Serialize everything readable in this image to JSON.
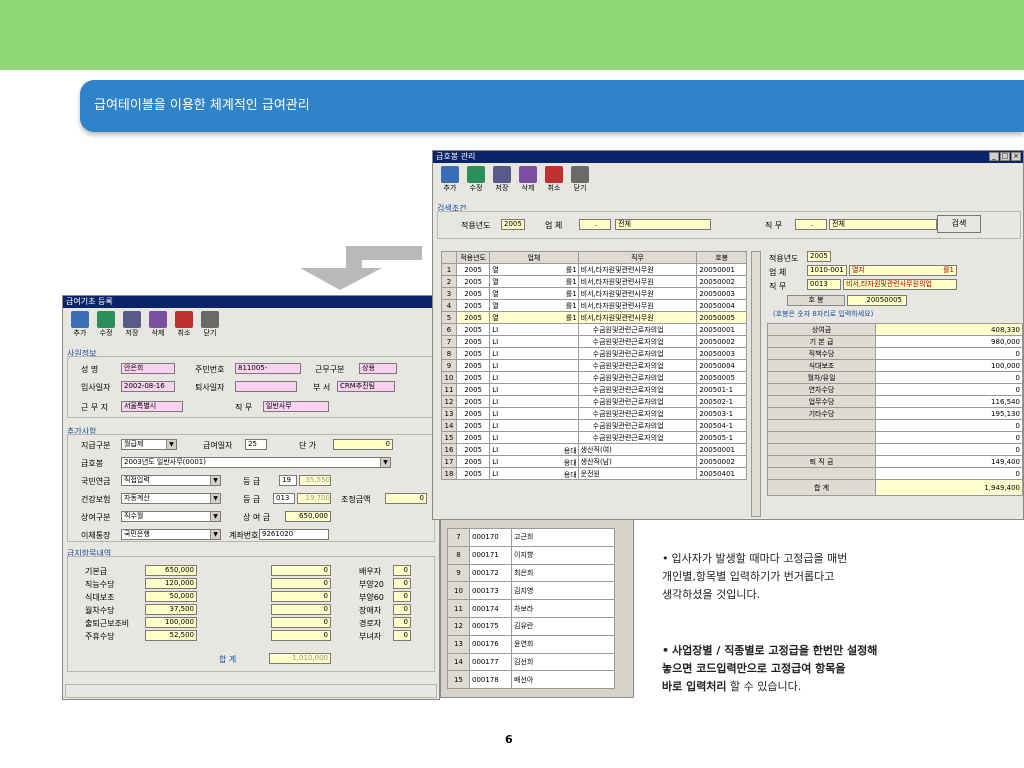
{
  "slide": {
    "title": "급여테이블을 이용한 체계적인 급여관리",
    "page_number": "6",
    "notes": [
      {
        "bullet": "•",
        "lines": [
          "입사자가 발생할 때마다 고정급을 매번",
          "개인별,항목별 입력하기가 번거롭다고",
          "생각하셨을 것입니다."
        ]
      },
      {
        "bullet": "•",
        "lines": [
          "사업장별 / 직종별로 고정급을 한번만 설정해",
          "놓으면 코드입력만으로 고정급여 항목을"
        ],
        "last_bold": "바로 입력처리",
        "last_rest": " 할 수 있습니다."
      }
    ],
    "colors": {
      "topbar": "#8fd878",
      "banner": "#2f84c9"
    }
  },
  "win1": {
    "title": "급여기초 등록",
    "toolbar": [
      {
        "label": "추가",
        "icon": "add-icon"
      },
      {
        "label": "수정",
        "icon": "edit-icon"
      },
      {
        "label": "저장",
        "icon": "save-icon"
      },
      {
        "label": "삭제",
        "icon": "delete-icon"
      },
      {
        "label": "취소",
        "icon": "cancel-icon"
      },
      {
        "label": "닫기",
        "icon": "close-icon"
      }
    ],
    "emp_section": "사원정보",
    "name_label": "성 명",
    "name_value": "안은희",
    "rrn_label": "주민번호",
    "rrn_value": "811005-",
    "worktype_label": "근무구분",
    "worktype_value": "상용",
    "hire_label": "입사일자",
    "hire_value": "2002-08-16",
    "retire_label": "퇴사일자",
    "retire_value": "",
    "dept_label": "부 서",
    "dept_value": "CRM추진팀",
    "site_label": "근 무 지",
    "site_value": "서울특별시",
    "job_label": "직 무",
    "job_value": "일반사무",
    "add_section": "추가사항",
    "paytype_label": "지급구분",
    "paytype_value": "월급제",
    "payday_label": "급여일자",
    "payday_value": "25",
    "unit_label": "단 가",
    "unit_value": "0",
    "grade_label": "급호봉",
    "grade_value": "2003년도 일반사무(0001)",
    "pension_label": "국민연금",
    "pension_value": "직접입력",
    "pgrade_label": "등 급",
    "pgrade_value": "19",
    "pgrade_amt": "35,550",
    "health_label": "건강보험",
    "health_value": "자동계산",
    "hgrade_label": "등 급",
    "hgrade_value": "013",
    "hgrade_amt": "19,700",
    "adjust_label": "조정금액",
    "adjust_value": "0",
    "bonus_label": "상여구분",
    "bonus_value": "직수월",
    "bonus_amt_label": "상 여 금",
    "bonus_amt_value": "650,000",
    "bank_label": "이체통장",
    "bank_value": "국민은행",
    "acct_label": "계좌번호",
    "acct_value": "9261020",
    "items_section": "급지항목내역",
    "items": [
      {
        "label": "기본급",
        "value": "650,000",
        "v2": "0"
      },
      {
        "label": "직능수당",
        "value": "120,000",
        "v2": "0"
      },
      {
        "label": "식대보조",
        "value": "50,000",
        "v2": "0"
      },
      {
        "label": "월차수당",
        "value": "37,500",
        "v2": "0"
      },
      {
        "label": "출퇴근보조비",
        "value": "100,000",
        "v2": "0"
      },
      {
        "label": "주휴수당",
        "value": "52,500",
        "v2": "0"
      }
    ],
    "family": [
      {
        "label": "배우자",
        "value": "0"
      },
      {
        "label": "부양20",
        "value": "0"
      },
      {
        "label": "부양60",
        "value": "0"
      },
      {
        "label": "장애자",
        "value": "0"
      },
      {
        "label": "경로자",
        "value": "0"
      },
      {
        "label": "부녀자",
        "value": "0"
      }
    ],
    "total_label": "합 계",
    "total_value": "1,010,000"
  },
  "win2": {
    "title": "급호봉 관리",
    "toolbar": [
      {
        "label": "추가",
        "icon": "add-icon"
      },
      {
        "label": "수정",
        "icon": "edit-icon"
      },
      {
        "label": "저장",
        "icon": "save-icon"
      },
      {
        "label": "삭제",
        "icon": "delete-icon"
      },
      {
        "label": "취소",
        "icon": "cancel-icon"
      },
      {
        "label": "닫기",
        "icon": "close-icon"
      }
    ],
    "search_section": "검색조건",
    "year_label": "적용년도",
    "year_value": "2005",
    "biz_label": "업 체",
    "biz_dot": ".",
    "biz_value": "전체",
    "job_label": "직 무",
    "job_dot": ".",
    "job_value": "전체",
    "search_button": "검색",
    "grid_headers": [
      "적용년도",
      "업체",
      "직무",
      "호봉"
    ],
    "rows": [
      {
        "n": "1",
        "year": "2005",
        "biz": "열",
        "bizr": "를1",
        "job": "비서,타자원및관련사무원",
        "grade": "20050001"
      },
      {
        "n": "2",
        "year": "2005",
        "biz": "열",
        "bizr": "를1",
        "job": "비서,타자원및관련사무원",
        "grade": "20050002"
      },
      {
        "n": "3",
        "year": "2005",
        "biz": "열",
        "bizr": "를1",
        "job": "비서,타자원및관련사무원",
        "grade": "20050003"
      },
      {
        "n": "4",
        "year": "2005",
        "biz": "열",
        "bizr": "를1",
        "job": "비서,타자원및관련사무원",
        "grade": "20050004"
      },
      {
        "n": "5",
        "year": "2005",
        "biz": "열",
        "bizr": "를1",
        "job": "비서,타자원및관련사무원",
        "grade": "20050005"
      },
      {
        "n": "6",
        "year": "2005",
        "biz": "LI",
        "bizr": "",
        "job": "수금원및관련근로자의업",
        "grade": "20050001"
      },
      {
        "n": "7",
        "year": "2005",
        "biz": "LI",
        "bizr": "",
        "job": "수금원및관련근로자의업",
        "grade": "20050002"
      },
      {
        "n": "8",
        "year": "2005",
        "biz": "LI",
        "bizr": "",
        "job": "수금원및관련근로자의업",
        "grade": "20050003"
      },
      {
        "n": "9",
        "year": "2005",
        "biz": "LI",
        "bizr": "",
        "job": "수금원및관련근로자의업",
        "grade": "20050004"
      },
      {
        "n": "10",
        "year": "2005",
        "biz": "LI",
        "bizr": "",
        "job": "수금원및관련근로자의업",
        "grade": "20050005"
      },
      {
        "n": "11",
        "year": "2005",
        "biz": "LI",
        "bizr": "",
        "job": "수금원및관련근로자의업",
        "grade": "200501-1"
      },
      {
        "n": "12",
        "year": "2005",
        "biz": "LI",
        "bizr": "",
        "job": "수금원및관련근로자의업",
        "grade": "200502-1"
      },
      {
        "n": "13",
        "year": "2005",
        "biz": "LI",
        "bizr": "",
        "job": "수금원및관련근로자의업",
        "grade": "200503-1"
      },
      {
        "n": "14",
        "year": "2005",
        "biz": "LI",
        "bizr": "",
        "job": "수금원및관련근로자의업",
        "grade": "200504-1"
      },
      {
        "n": "15",
        "year": "2005",
        "biz": "LI",
        "bizr": "",
        "job": "수금원및관련근로자의업",
        "grade": "200505-1"
      },
      {
        "n": "16",
        "year": "2005",
        "biz": "LI",
        "bizr": "용대",
        "job": "생산직(여)",
        "grade": "20050001"
      },
      {
        "n": "17",
        "year": "2005",
        "biz": "LI",
        "bizr": "용대",
        "job": "생산직(남)",
        "grade": "20050002"
      },
      {
        "n": "18",
        "year": "2005",
        "biz": "LI",
        "bizr": "용대",
        "job": "운전원",
        "grade": "20050401"
      }
    ],
    "r_year_label": "적용년도",
    "r_year_value": "2005",
    "r_biz_label": "업 체",
    "r_biz_code": "1010-001",
    "r_biz_name": "열지",
    "r_biz_tail": "를1",
    "r_job_label": "직 무",
    "r_job_code": "0013",
    "r_job_name": "비서,타자원및관련사무원의업",
    "r_grade_label": "호 봉",
    "r_grade_value": "20050005",
    "r_hint": "(호봉은 숫자 8자리로 입력하세요)",
    "right_items": [
      {
        "label": "상여금",
        "value": "408,330"
      },
      {
        "label": "기 본 급",
        "value": "980,000"
      },
      {
        "label": "직책수당",
        "value": "0"
      },
      {
        "label": "식대보조",
        "value": "100,000"
      },
      {
        "label": "월차/유일",
        "value": "0"
      },
      {
        "label": "연차수당",
        "value": "0"
      },
      {
        "label": "업무수당",
        "value": "116,540"
      },
      {
        "label": "기타수당",
        "value": "195,130"
      },
      {
        "label": "",
        "value": "0"
      },
      {
        "label": "",
        "value": "0"
      },
      {
        "label": "",
        "value": "0"
      },
      {
        "label": "퇴 직 금",
        "value": "149,400"
      },
      {
        "label": "",
        "value": "0"
      }
    ],
    "r_total_label": "합 계",
    "r_total_value": "1,949,400"
  },
  "win3": {
    "rows": [
      {
        "n": "7",
        "code": "000170",
        "name": "고근희"
      },
      {
        "n": "8",
        "code": "000171",
        "name": "이지향"
      },
      {
        "n": "9",
        "code": "000172",
        "name": "최은희"
      },
      {
        "n": "10",
        "code": "000173",
        "name": "김지영"
      },
      {
        "n": "11",
        "code": "000174",
        "name": "차보라"
      },
      {
        "n": "12",
        "code": "000175",
        "name": "김유란"
      },
      {
        "n": "13",
        "code": "000176",
        "name": "윤연희"
      },
      {
        "n": "14",
        "code": "000177",
        "name": "김선희"
      },
      {
        "n": "15",
        "code": "000178",
        "name": "배선아"
      }
    ]
  }
}
